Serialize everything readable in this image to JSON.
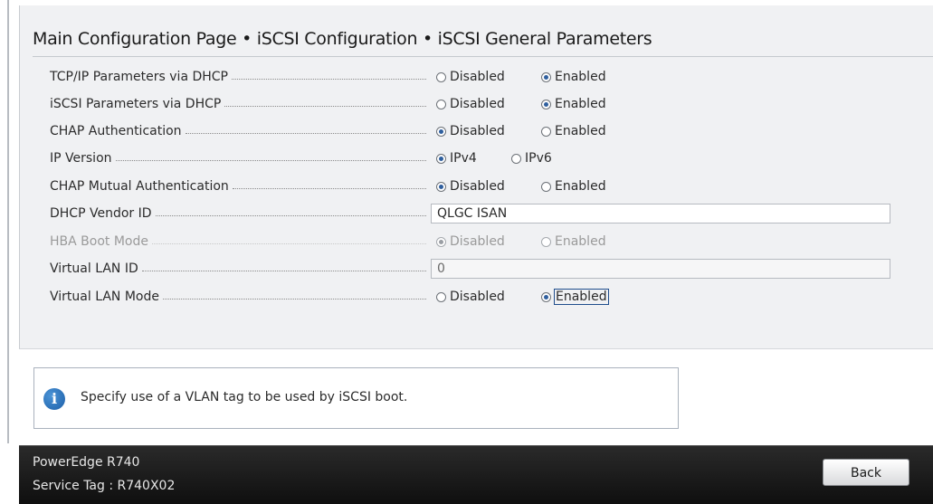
{
  "page": {
    "title": "Main Configuration Page • iSCSI Configuration • iSCSI General Parameters"
  },
  "rows": [
    {
      "label": "TCP/IP Parameters via DHCP",
      "type": "radio",
      "options": [
        "Disabled",
        "Enabled"
      ],
      "selected": "Enabled",
      "disabled": false
    },
    {
      "label": "iSCSI Parameters via DHCP",
      "type": "radio",
      "options": [
        "Disabled",
        "Enabled"
      ],
      "selected": "Enabled",
      "disabled": false
    },
    {
      "label": "CHAP Authentication",
      "type": "radio",
      "options": [
        "Disabled",
        "Enabled"
      ],
      "selected": "Disabled",
      "disabled": false
    },
    {
      "label": "IP Version",
      "type": "radio",
      "options": [
        "IPv4",
        "IPv6"
      ],
      "selected": "IPv4",
      "disabled": false
    },
    {
      "label": "CHAP Mutual Authentication",
      "type": "radio",
      "options": [
        "Disabled",
        "Enabled"
      ],
      "selected": "Disabled",
      "disabled": false
    },
    {
      "label": "DHCP Vendor ID",
      "type": "text",
      "value": "QLGC ISAN",
      "disabled": false
    },
    {
      "label": "HBA Boot Mode",
      "type": "radio",
      "options": [
        "Disabled",
        "Enabled"
      ],
      "selected": "Disabled",
      "disabled": true
    },
    {
      "label": "Virtual LAN ID",
      "type": "text",
      "value": "0",
      "disabled": false
    },
    {
      "label": "Virtual LAN Mode",
      "type": "radio",
      "options": [
        "Disabled",
        "Enabled"
      ],
      "selected": "Enabled",
      "disabled": false,
      "focused": "Enabled"
    }
  ],
  "help": {
    "icon": "info-icon",
    "text": "Specify use of a VLAN tag to be used by iSCSI boot."
  },
  "footer": {
    "model": "PowerEdge R740",
    "service_tag": "Service Tag : R740X02",
    "back_label": "Back"
  },
  "colors": {
    "panel_bg": "#f0f1f3",
    "footer_bg": "#1a1a1a",
    "radio_selected": "#2f5f9e",
    "info_icon": "#1d5fa8"
  }
}
